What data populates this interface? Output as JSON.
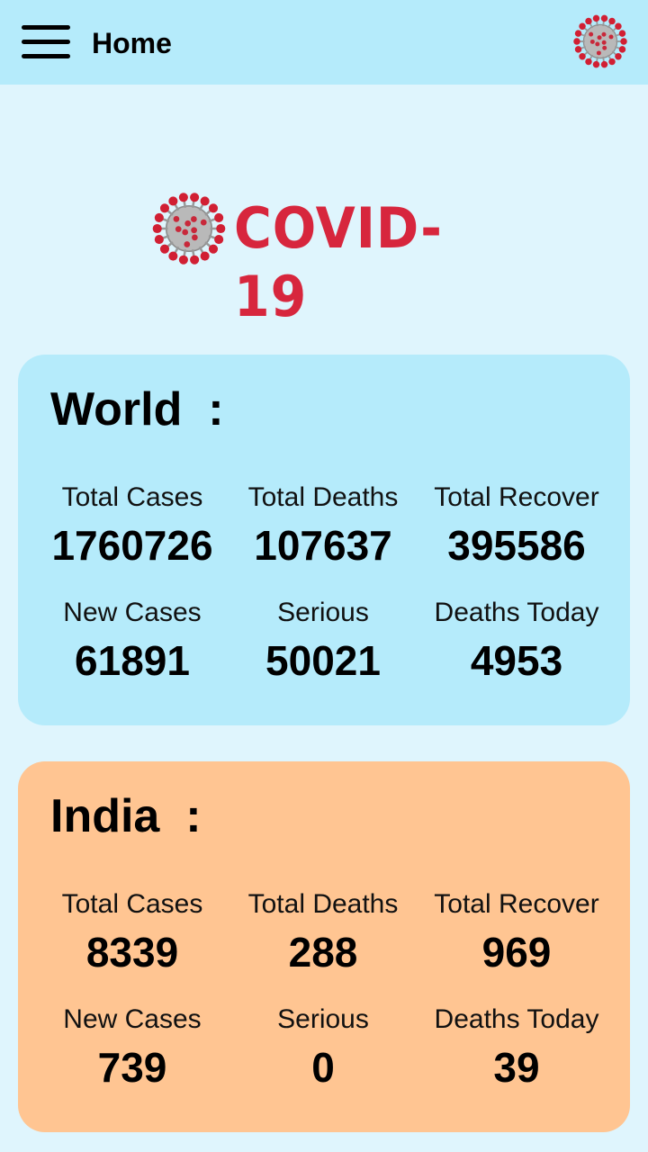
{
  "appbar": {
    "title": "Home"
  },
  "logo": {
    "text": "COVID-19"
  },
  "colors": {
    "appbar": "#b5ebfb",
    "background": "#dff5fd",
    "world_card": "#b5ebfb",
    "india_card": "#ffc592",
    "logo_red": "#d7263d"
  },
  "world": {
    "title": "World  :",
    "stats": [
      {
        "label": "Total Cases",
        "value": "1760726"
      },
      {
        "label": "Total Deaths",
        "value": "107637"
      },
      {
        "label": "Total Recover",
        "value": "395586"
      },
      {
        "label": "New Cases",
        "value": "61891"
      },
      {
        "label": "Serious",
        "value": "50021"
      },
      {
        "label": "Deaths Today",
        "value": "4953"
      }
    ]
  },
  "india": {
    "title": "India  :",
    "stats": [
      {
        "label": "Total Cases",
        "value": "8339"
      },
      {
        "label": "Total Deaths",
        "value": "288"
      },
      {
        "label": "Total Recover",
        "value": "969"
      },
      {
        "label": "New Cases",
        "value": "739"
      },
      {
        "label": "Serious",
        "value": "0"
      },
      {
        "label": "Deaths Today",
        "value": "39"
      }
    ]
  },
  "icons": {
    "menu": "hamburger-menu-icon",
    "virus": "coronavirus-icon"
  }
}
